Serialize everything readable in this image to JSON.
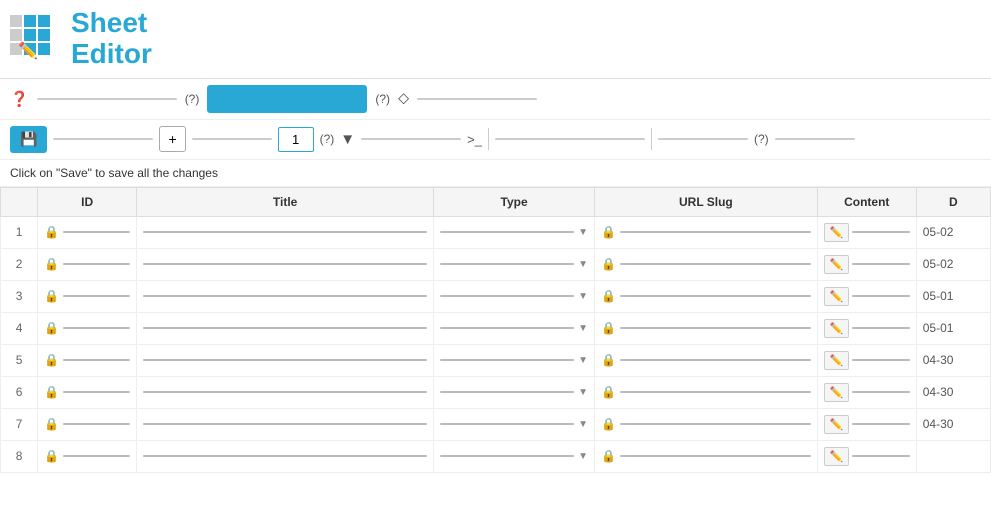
{
  "app": {
    "title_line1": "Sheet",
    "title_line2": "Editor"
  },
  "toolbar1": {
    "help_label": "?",
    "hint1_label": "(?)",
    "hint2_label": "(?)",
    "sort_char": "⬛"
  },
  "toolbar2": {
    "save_icon": "💾",
    "add_icon": "+",
    "add_number": "1",
    "hint_label": "(?)",
    "filter_icon": "▼",
    "cmd_prefix": ">_",
    "hint2_label": "(?)"
  },
  "info_bar": {
    "message": "Click on \"Save\" to save all the changes"
  },
  "table": {
    "columns": [
      "ID",
      "Title",
      "Type",
      "URL Slug",
      "Content",
      "D"
    ],
    "rows": [
      {
        "num": 1,
        "date": "05-02"
      },
      {
        "num": 2,
        "date": "05-02"
      },
      {
        "num": 3,
        "date": "05-01"
      },
      {
        "num": 4,
        "date": "05-01"
      },
      {
        "num": 5,
        "date": "04-30"
      },
      {
        "num": 6,
        "date": "04-30"
      },
      {
        "num": 7,
        "date": "04-30"
      },
      {
        "num": 8,
        "date": ""
      }
    ]
  },
  "colors": {
    "accent": "#29a8d5"
  }
}
